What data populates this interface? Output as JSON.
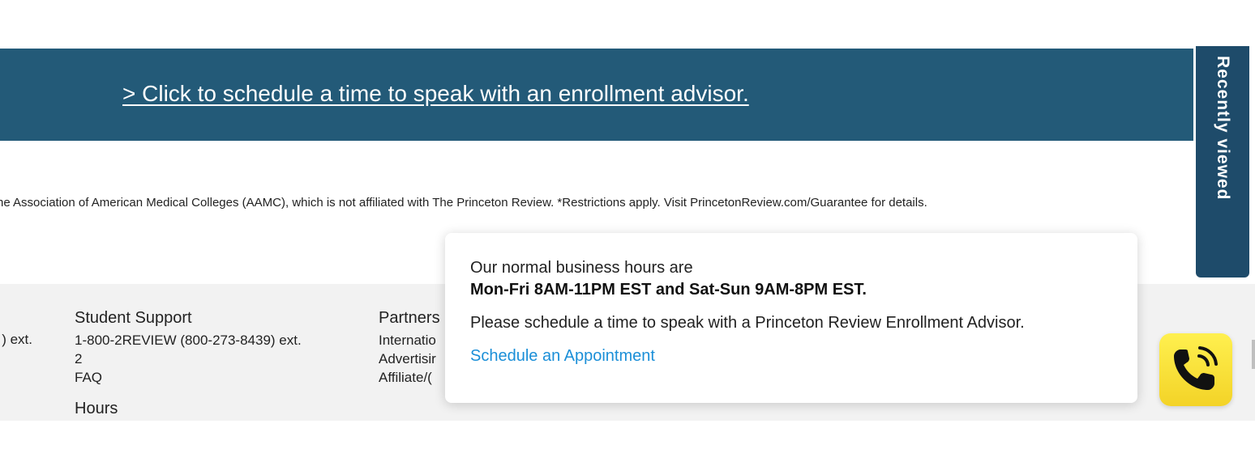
{
  "banner": {
    "link_text": "> Click to schedule a time to speak with an enrollment advisor.",
    "bg_color": "#235a78"
  },
  "disclaimer": {
    "text": "he Association of American Medical Colleges (AAMC), which is not affiliated with The Princeton Review. *Restrictions apply. Visit PrincetonReview.com/Guarantee for details."
  },
  "recently_viewed": {
    "label": "Recently viewed",
    "bg_color": "#1e4b6a"
  },
  "footer": {
    "left_fragment": ") ext.",
    "student_support": {
      "heading": "Student Support",
      "phone_line1": "1-800-2REVIEW (800-273-8439) ext.",
      "phone_line2": "2",
      "faq": "FAQ",
      "hours_heading": "Hours"
    },
    "partners": {
      "heading": "Partners",
      "items": [
        "Internatio",
        "Advertisir",
        "Affiliate/("
      ]
    }
  },
  "popup": {
    "line1": "Our normal business hours are",
    "line2": "Mon-Fri 8AM-11PM EST and Sat-Sun 9AM-8PM EST.",
    "line3": "Please schedule a time to speak with a Princeton Review Enrollment Advisor.",
    "cta": "Schedule an Appointment",
    "cta_color": "#1b8fd8"
  },
  "call_button": {
    "icon": "phone-ringing-icon",
    "bg_color": "#fbe43a"
  }
}
